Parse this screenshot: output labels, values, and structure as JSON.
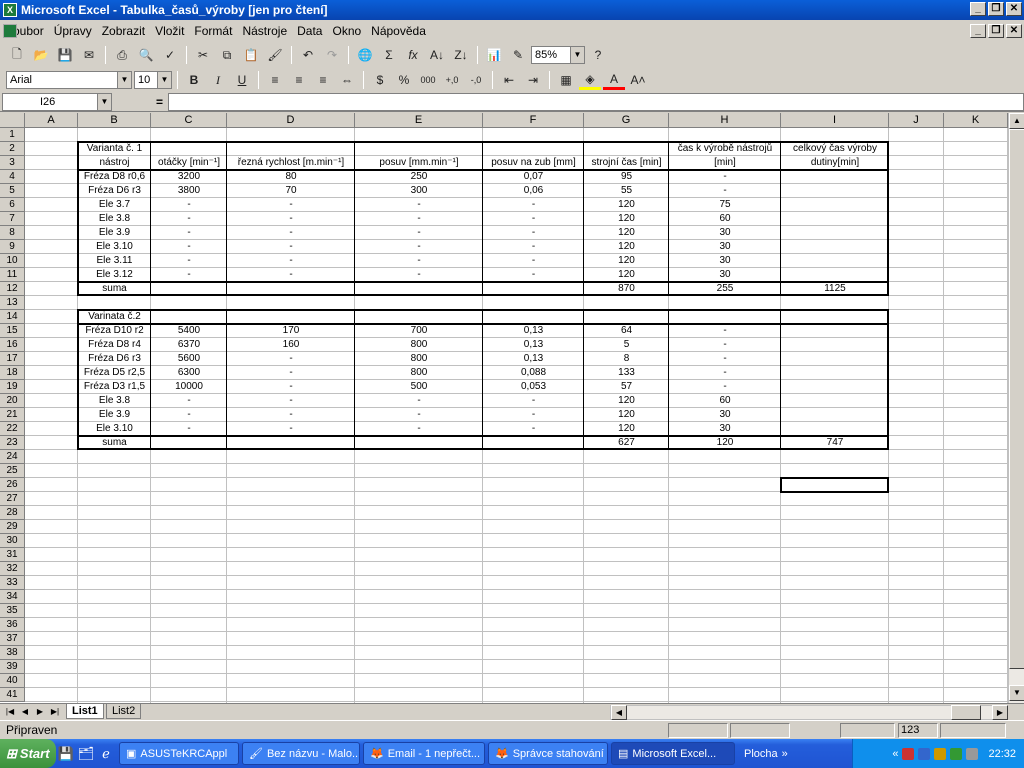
{
  "window": {
    "title": "Microsoft Excel - Tabulka_časů_výroby  [jen pro čtení]",
    "app_icon": "excel-icon"
  },
  "menu": [
    "Soubor",
    "Úpravy",
    "Zobrazit",
    "Vložit",
    "Formát",
    "Nástroje",
    "Data",
    "Okno",
    "Nápověda"
  ],
  "toolbar": {
    "zoom": "85%"
  },
  "format": {
    "font": "Arial",
    "size": "10",
    "bold": "B",
    "italic": "I",
    "underline": "U"
  },
  "formula": {
    "name_box": "I26",
    "fx": "=",
    "value": ""
  },
  "columns": [
    "A",
    "B",
    "C",
    "D",
    "E",
    "F",
    "G",
    "H",
    "I",
    "J",
    "K"
  ],
  "rows": [
    "1",
    "2",
    "3",
    "4",
    "5",
    "6",
    "7",
    "8",
    "9",
    "10",
    "11",
    "12",
    "13",
    "14",
    "15",
    "16",
    "17",
    "18",
    "19",
    "20",
    "21",
    "22",
    "23",
    "24",
    "25",
    "26",
    "27",
    "28",
    "29",
    "30",
    "31",
    "32",
    "33",
    "34",
    "35",
    "36",
    "37",
    "38",
    "39",
    "40",
    "41"
  ],
  "table1": {
    "title1": "Varianta č. 1",
    "title2": "nástroj",
    "headers": [
      "otáčky [min⁻¹]",
      "řezná rychlost [m.min⁻¹]",
      "posuv [mm.min⁻¹]",
      "posuv na zub [mm]",
      "strojní čas [min]",
      "čas k výrobě nástrojů [min]",
      "celkový čas výroby dutiny[min]"
    ],
    "h_tool_time_1": "čas k výrobě nástrojů",
    "h_tool_time_2": "[min]",
    "h_total_1": "celkový čas výroby",
    "h_total_2": "dutiny[min]",
    "rows": [
      [
        "Fréza D8 r0,6",
        "3200",
        "80",
        "250",
        "0,07",
        "95",
        "-",
        ""
      ],
      [
        "Fréza D6 r3",
        "3800",
        "70",
        "300",
        "0,06",
        "55",
        "-",
        ""
      ],
      [
        "Ele 3.7",
        "-",
        "-",
        "-",
        "-",
        "120",
        "75",
        ""
      ],
      [
        "Ele 3.8",
        "-",
        "-",
        "-",
        "-",
        "120",
        "60",
        ""
      ],
      [
        "Ele 3.9",
        "-",
        "-",
        "-",
        "-",
        "120",
        "30",
        ""
      ],
      [
        "Ele 3.10",
        "-",
        "-",
        "-",
        "-",
        "120",
        "30",
        ""
      ],
      [
        "Ele 3.11",
        "-",
        "-",
        "-",
        "-",
        "120",
        "30",
        ""
      ],
      [
        "Ele 3.12",
        "-",
        "-",
        "-",
        "-",
        "120",
        "30",
        ""
      ],
      [
        "suma",
        "",
        "",
        "",
        "",
        "870",
        "255",
        "1125"
      ]
    ]
  },
  "table2": {
    "title": "Varinata č.2",
    "rows": [
      [
        "Fréza D10 r2",
        "5400",
        "170",
        "700",
        "0,13",
        "64",
        "-",
        ""
      ],
      [
        "Fréza D8 r4",
        "6370",
        "160",
        "800",
        "0,13",
        "5",
        "-",
        ""
      ],
      [
        "Fréza D6 r3",
        "5600",
        "-",
        "800",
        "0,13",
        "8",
        "-",
        ""
      ],
      [
        "Fréza D5 r2,5",
        "6300",
        "-",
        "800",
        "0,088",
        "133",
        "-",
        ""
      ],
      [
        "Fréza D3 r1,5",
        "10000",
        "-",
        "500",
        "0,053",
        "57",
        "-",
        ""
      ],
      [
        "Ele 3.8",
        "-",
        "-",
        "-",
        "-",
        "120",
        "60",
        ""
      ],
      [
        "Ele 3.9",
        "-",
        "-",
        "-",
        "-",
        "120",
        "30",
        ""
      ],
      [
        "Ele 3.10",
        "-",
        "-",
        "-",
        "-",
        "120",
        "30",
        ""
      ],
      [
        "suma",
        "",
        "",
        "",
        "",
        "627",
        "120",
        "747"
      ]
    ]
  },
  "sheets": [
    "List1",
    "List2"
  ],
  "status": {
    "text": "Připraven",
    "num": "123"
  },
  "taskbar": {
    "start": "Start",
    "tasks": [
      "ASUSTeKRCAppl",
      "Bez názvu - Malo...",
      "Email - 1 nepřečt...",
      "Správce stahování",
      "Microsoft Excel...",
      "Plocha"
    ],
    "clock": "22:32"
  }
}
